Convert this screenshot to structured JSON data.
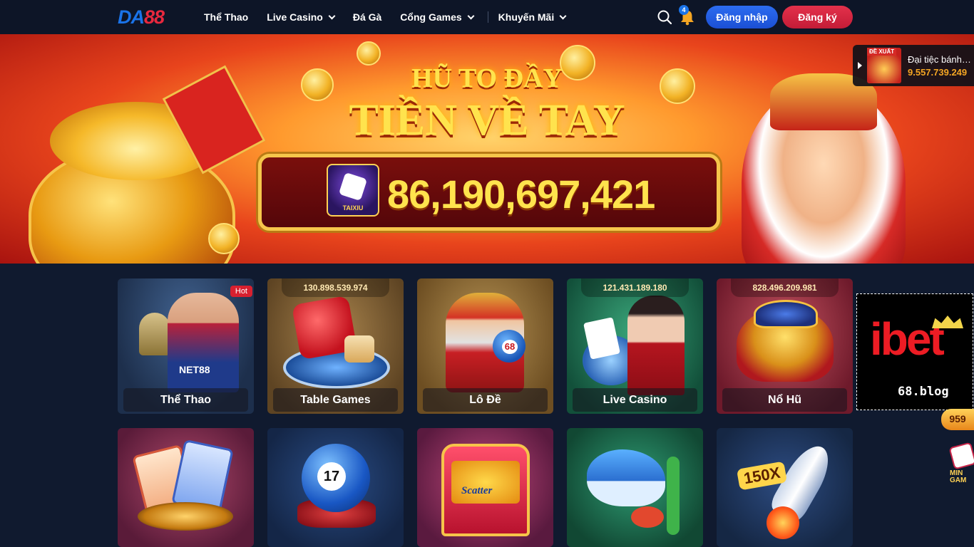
{
  "brand": {
    "logo_da": "DA",
    "logo_88": "88"
  },
  "nav": {
    "items": [
      {
        "label": "Thể Thao",
        "dropdown": false
      },
      {
        "label": "Live Casino",
        "dropdown": true
      },
      {
        "label": "Đá Gà",
        "dropdown": false
      },
      {
        "label": "Cổng Games",
        "dropdown": true
      },
      {
        "label": "Khuyến Mãi",
        "dropdown": true
      }
    ]
  },
  "header": {
    "notification_count": "4",
    "login_label": "Đăng nhập",
    "register_label": "Đăng ký"
  },
  "banner": {
    "headline_top": "HŨ TO ĐẦY",
    "headline_main": "TIỀN VỀ TAY",
    "jackpot_game": "TAIXIU",
    "jackpot_amount": "86,190,697,421"
  },
  "promo": {
    "tag": "ĐỀ XUẤT",
    "title": "Đại tiệc bánh ...",
    "amount": "9.557.739.249"
  },
  "games_row1": [
    {
      "label": "Thể Thao",
      "amount": "",
      "hot": "Hot"
    },
    {
      "label": "Table Games",
      "amount": "130.898.539.974",
      "hot": ""
    },
    {
      "label": "Lô Đề",
      "amount": "",
      "hot": ""
    },
    {
      "label": "Live Casino",
      "amount": "121.431.189.180",
      "hot": ""
    },
    {
      "label": "Nổ Hũ",
      "amount": "828.496.209.981",
      "hot": ""
    }
  ],
  "games_row2": [
    {
      "art_text": ""
    },
    {
      "art_text": "17"
    },
    {
      "art_text": "Scatter"
    },
    {
      "art_text": ""
    },
    {
      "art_text": "150X"
    }
  ],
  "card_art": {
    "sports_jersey": "NET88",
    "lode_ball": "68"
  },
  "side_ad": {
    "logo": "ibet",
    "domain": "68.blog"
  },
  "side_badge": "959",
  "mini_game": {
    "line1": "MIN",
    "line2": "GAM"
  },
  "colors": {
    "header_bg": "#0d1527",
    "page_bg": "#101a2f",
    "login_blue": "#2c6cf0",
    "register_red": "#e3314b",
    "jackpot_gold": "#ffe34d"
  }
}
